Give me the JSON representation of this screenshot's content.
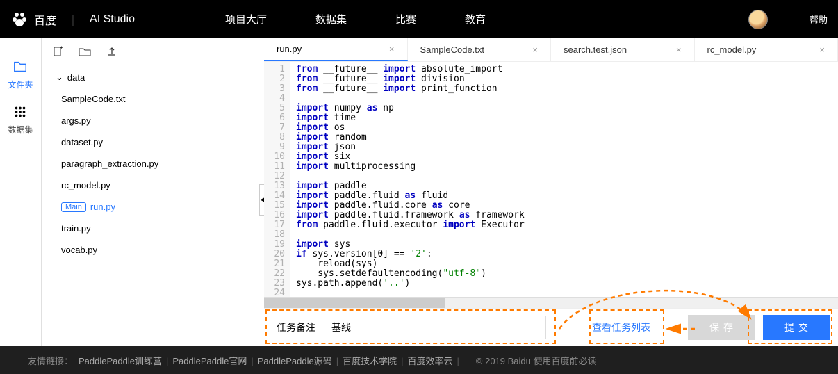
{
  "nav": {
    "logo_brand": "百度",
    "logo_product": "AI Studio",
    "items": [
      "项目大厅",
      "数据集",
      "比赛",
      "教育"
    ],
    "help": "帮助"
  },
  "leftbar": {
    "files": "文件夹",
    "dataset": "数据集"
  },
  "filetree": {
    "folder": "data",
    "main_badge": "Main",
    "files": [
      "SampleCode.txt",
      "args.py",
      "dataset.py",
      "paragraph_extraction.py",
      "rc_model.py",
      "run.py",
      "train.py",
      "vocab.py"
    ],
    "active_index": 5
  },
  "tabs": [
    {
      "label": "run.py",
      "active": true
    },
    {
      "label": "SampleCode.txt",
      "active": false
    },
    {
      "label": "search.test.json",
      "active": false
    },
    {
      "label": "rc_model.py",
      "active": false
    }
  ],
  "code": [
    {
      "n": 1,
      "tokens": [
        [
          "kw",
          "from"
        ],
        [
          "t",
          " __future__ "
        ],
        [
          "kw",
          "import"
        ],
        [
          "t",
          " absolute_import"
        ]
      ]
    },
    {
      "n": 2,
      "tokens": [
        [
          "kw",
          "from"
        ],
        [
          "t",
          " __future__ "
        ],
        [
          "kw",
          "import"
        ],
        [
          "t",
          " division"
        ]
      ]
    },
    {
      "n": 3,
      "tokens": [
        [
          "kw",
          "from"
        ],
        [
          "t",
          " __future__ "
        ],
        [
          "kw",
          "import"
        ],
        [
          "t",
          " print_function"
        ]
      ]
    },
    {
      "n": 4,
      "tokens": []
    },
    {
      "n": 5,
      "tokens": [
        [
          "kw",
          "import"
        ],
        [
          "t",
          " numpy "
        ],
        [
          "kw",
          "as"
        ],
        [
          "t",
          " np"
        ]
      ]
    },
    {
      "n": 6,
      "tokens": [
        [
          "kw",
          "import"
        ],
        [
          "t",
          " time"
        ]
      ]
    },
    {
      "n": 7,
      "tokens": [
        [
          "kw",
          "import"
        ],
        [
          "t",
          " os"
        ]
      ]
    },
    {
      "n": 8,
      "tokens": [
        [
          "kw",
          "import"
        ],
        [
          "t",
          " random"
        ]
      ]
    },
    {
      "n": 9,
      "tokens": [
        [
          "kw",
          "import"
        ],
        [
          "t",
          " json"
        ]
      ]
    },
    {
      "n": 10,
      "tokens": [
        [
          "kw",
          "import"
        ],
        [
          "t",
          " six"
        ]
      ]
    },
    {
      "n": 11,
      "tokens": [
        [
          "kw",
          "import"
        ],
        [
          "t",
          " multiprocessing"
        ]
      ]
    },
    {
      "n": 12,
      "tokens": []
    },
    {
      "n": 13,
      "tokens": [
        [
          "kw",
          "import"
        ],
        [
          "t",
          " paddle"
        ]
      ]
    },
    {
      "n": 14,
      "tokens": [
        [
          "kw",
          "import"
        ],
        [
          "t",
          " paddle.fluid "
        ],
        [
          "kw",
          "as"
        ],
        [
          "t",
          " fluid"
        ]
      ]
    },
    {
      "n": 15,
      "tokens": [
        [
          "kw",
          "import"
        ],
        [
          "t",
          " paddle.fluid.core "
        ],
        [
          "kw",
          "as"
        ],
        [
          "t",
          " core"
        ]
      ]
    },
    {
      "n": 16,
      "tokens": [
        [
          "kw",
          "import"
        ],
        [
          "t",
          " paddle.fluid.framework "
        ],
        [
          "kw",
          "as"
        ],
        [
          "t",
          " framework"
        ]
      ]
    },
    {
      "n": 17,
      "tokens": [
        [
          "kw",
          "from"
        ],
        [
          "t",
          " paddle.fluid.executor "
        ],
        [
          "kw",
          "import"
        ],
        [
          "t",
          " Executor"
        ]
      ]
    },
    {
      "n": 18,
      "tokens": []
    },
    {
      "n": 19,
      "tokens": [
        [
          "kw",
          "import"
        ],
        [
          "t",
          " sys"
        ]
      ]
    },
    {
      "n": 20,
      "tokens": [
        [
          "kw",
          "if"
        ],
        [
          "t",
          " sys.version[0] == "
        ],
        [
          "str",
          "'2'"
        ],
        [
          "t",
          ":"
        ]
      ]
    },
    {
      "n": 21,
      "tokens": [
        [
          "t",
          "    reload(sys)"
        ]
      ]
    },
    {
      "n": 22,
      "tokens": [
        [
          "t",
          "    sys.setdefaultencoding("
        ],
        [
          "str",
          "\"utf-8\""
        ],
        [
          "t",
          ")"
        ]
      ]
    },
    {
      "n": 23,
      "tokens": [
        [
          "t",
          "sys.path.append("
        ],
        [
          "str",
          "'..'"
        ],
        [
          "t",
          ")"
        ]
      ]
    },
    {
      "n": 24,
      "tokens": []
    }
  ],
  "bottombar": {
    "label": "任务备注",
    "input_value": "基线",
    "view_link": "查看任务列表",
    "save": "保存",
    "submit": "提交"
  },
  "footer": {
    "prefix": "友情链接：",
    "links": [
      "PaddlePaddle训练营",
      "PaddlePaddle官网",
      "PaddlePaddle源码",
      "百度技术学院",
      "百度效率云"
    ],
    "copyright": "© 2019 Baidu 使用百度前必读"
  }
}
